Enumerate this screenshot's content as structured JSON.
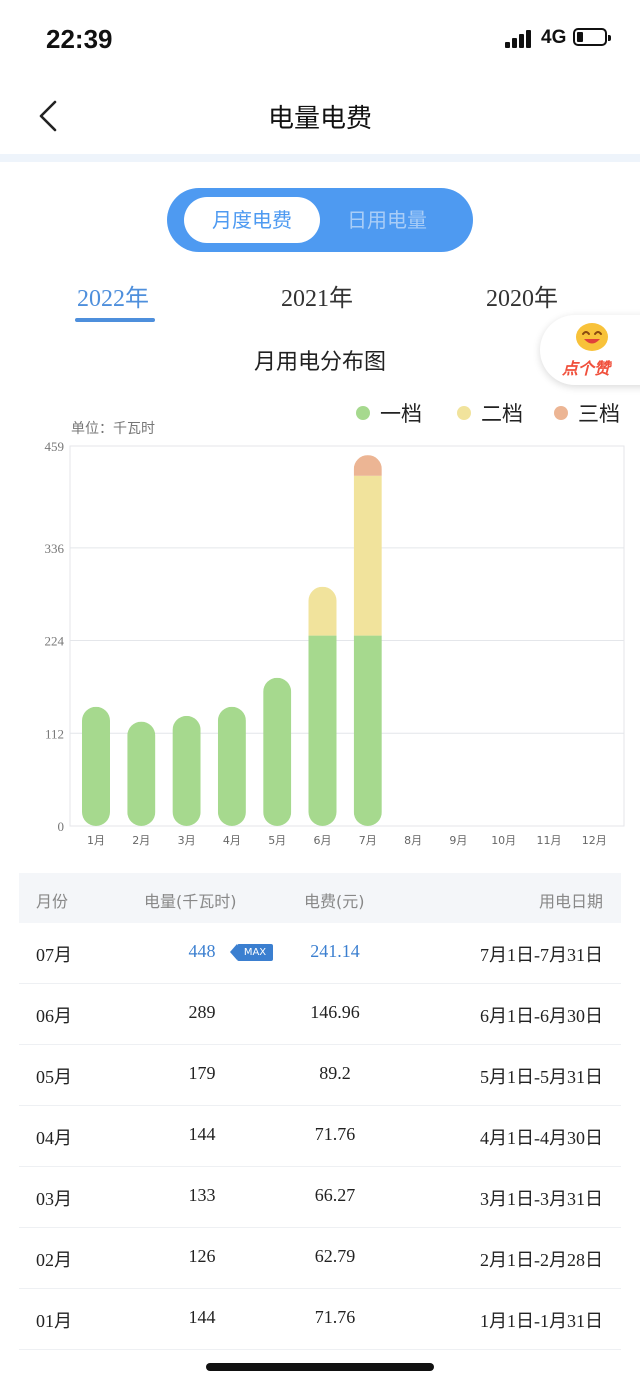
{
  "status": {
    "time": "22:39",
    "network": "4G"
  },
  "nav": {
    "title": "电量电费"
  },
  "segment": {
    "options": [
      "月度电费",
      "日用电量"
    ],
    "active": 0
  },
  "years": {
    "items": [
      "2022年",
      "2021年",
      "2020年"
    ],
    "active": 0
  },
  "like_badge": {
    "label": "点个赞"
  },
  "chart_title": "月用电分布图",
  "legend": [
    {
      "label": "一档",
      "color": "#a6d98e"
    },
    {
      "label": "二档",
      "color": "#f1e39c"
    },
    {
      "label": "三档",
      "color": "#ecb594"
    }
  ],
  "unit_label": "单位：千瓦时",
  "chart_data": {
    "type": "bar",
    "stacked": true,
    "categories": [
      "1月",
      "2月",
      "3月",
      "4月",
      "5月",
      "6月",
      "7月",
      "8月",
      "9月",
      "10月",
      "11月",
      "12月"
    ],
    "series": [
      {
        "name": "一档",
        "values": [
          144,
          126,
          133,
          144,
          179,
          230,
          230,
          null,
          null,
          null,
          null,
          null
        ]
      },
      {
        "name": "二档",
        "values": [
          0,
          0,
          0,
          0,
          0,
          59,
          193,
          null,
          null,
          null,
          null,
          null
        ]
      },
      {
        "name": "三档",
        "values": [
          0,
          0,
          0,
          0,
          0,
          0,
          25,
          null,
          null,
          null,
          null,
          null
        ]
      }
    ],
    "yticks": [
      0,
      112,
      224,
      336,
      459
    ],
    "ylim": [
      0,
      459
    ],
    "grid": true,
    "legend_position": "top-right"
  },
  "table": {
    "headers": [
      "月份",
      "电量(千瓦时)",
      "电费(元)",
      "用电日期"
    ],
    "max_badge": "MAX",
    "rows": [
      {
        "month": "07月",
        "kwh": "448",
        "fee": "241.14",
        "date": "7月1日-7月31日",
        "max": true
      },
      {
        "month": "06月",
        "kwh": "289",
        "fee": "146.96",
        "date": "6月1日-6月30日"
      },
      {
        "month": "05月",
        "kwh": "179",
        "fee": "89.2",
        "date": "5月1日-5月31日"
      },
      {
        "month": "04月",
        "kwh": "144",
        "fee": "71.76",
        "date": "4月1日-4月30日"
      },
      {
        "month": "03月",
        "kwh": "133",
        "fee": "66.27",
        "date": "3月1日-3月31日"
      },
      {
        "month": "02月",
        "kwh": "126",
        "fee": "62.79",
        "date": "2月1日-2月28日"
      },
      {
        "month": "01月",
        "kwh": "144",
        "fee": "71.76",
        "date": "1月1日-1月31日"
      }
    ]
  }
}
